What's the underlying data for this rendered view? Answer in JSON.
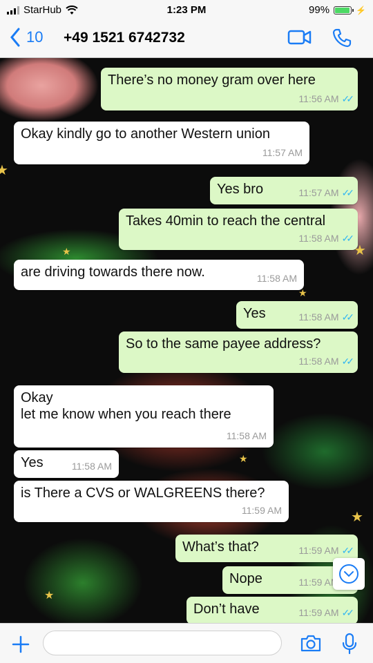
{
  "status": {
    "carrier": "StarHub",
    "time": "1:23 PM",
    "battery": "99%",
    "battery_level": 0.99
  },
  "nav": {
    "back_count": "10",
    "title": "+49 1521 6742732"
  },
  "messages": [
    {
      "dir": "out",
      "text": "There’s no money gram over here",
      "time": "11:56 AM"
    },
    {
      "dir": "in",
      "text": "Okay kindly go to another Western union",
      "time": "11:57 AM"
    },
    {
      "dir": "out",
      "text": "Yes bro",
      "time": "11:57 AM"
    },
    {
      "dir": "out",
      "text": "Takes 40min to reach the central",
      "time": "11:58 AM"
    },
    {
      "dir": "in",
      "text": "are driving towards there now.",
      "time": "11:58 AM"
    },
    {
      "dir": "out",
      "text": "Yes",
      "time": "11:58 AM"
    },
    {
      "dir": "out",
      "text": "So to the same payee address?",
      "time": "11:58 AM"
    },
    {
      "dir": "in",
      "text": "Okay",
      "text2": "let me know when you reach there",
      "time": "11:58 AM"
    },
    {
      "dir": "in",
      "text": "Yes",
      "time": "11:58 AM"
    },
    {
      "dir": "in",
      "text": "is There a CVS or WALGREENS there?",
      "time": "11:59 AM"
    },
    {
      "dir": "out",
      "text": "What’s that?",
      "time": "11:59 AM"
    },
    {
      "dir": "out",
      "text": "Nope",
      "time": "11:59 AM"
    },
    {
      "dir": "out",
      "text": "Don’t have",
      "time": "11:59 AM"
    }
  ],
  "input": {
    "placeholder": ""
  },
  "icons": {
    "back": "chevron-left-icon",
    "video": "video-call-icon",
    "phone": "phone-call-icon",
    "plus": "plus-icon",
    "camera": "camera-icon",
    "mic": "microphone-icon",
    "scroll": "chevron-down-icon"
  },
  "colors": {
    "accent": "#1a7cf5",
    "outgoing": "#dcf8c6",
    "incoming": "#ffffff",
    "read_ticks": "#34b7f1"
  }
}
